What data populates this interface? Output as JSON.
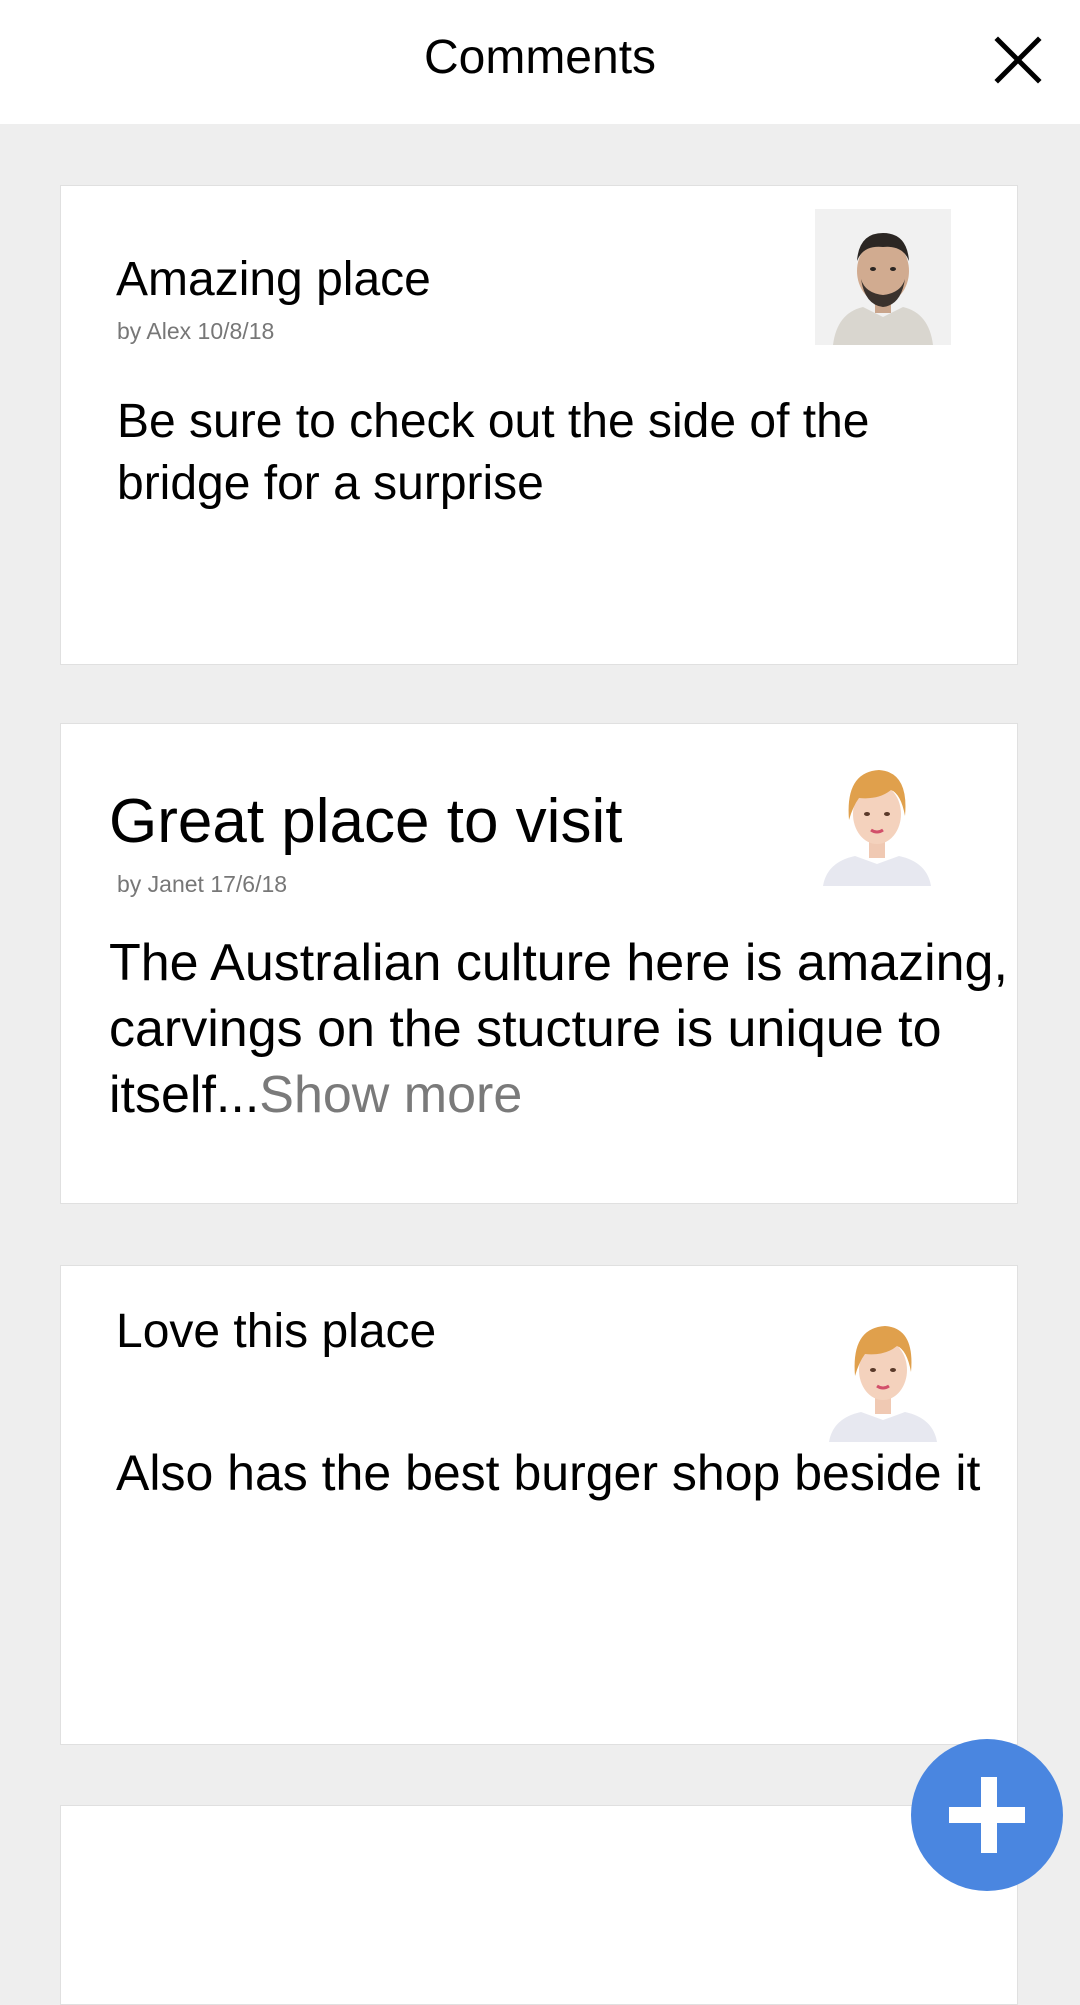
{
  "header": {
    "title": "Comments",
    "close_icon": "close-icon"
  },
  "comments": [
    {
      "title": "Amazing place",
      "meta": "by Alex 10/8/18",
      "body": "Be sure to check out the side of the bridge for a surprise",
      "avatar": "avatar-alex"
    },
    {
      "title": "Great place to visit",
      "meta": "by Janet 17/6/18",
      "body": "The Australian culture here is amazing, carvings on the stucture is unique to itself...",
      "show_more": "Show more",
      "avatar": "avatar-janet"
    },
    {
      "title": "Love this place",
      "body": "Also has the best burger shop beside it",
      "avatar": "avatar-janet"
    }
  ],
  "fab": {
    "icon": "plus-icon"
  },
  "colors": {
    "background": "#eeeeee",
    "card": "#ffffff",
    "accent": "#4a86e0",
    "meta_text": "#777777"
  }
}
